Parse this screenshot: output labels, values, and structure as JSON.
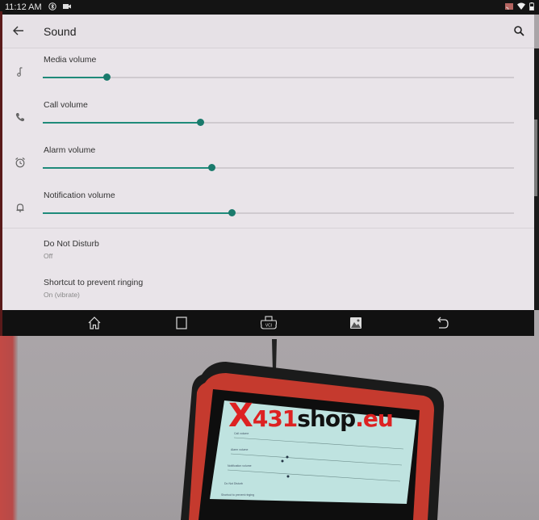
{
  "status_bar": {
    "time": "11:12 AM",
    "left_icons": [
      "bluetooth-icon",
      "video-camera-icon"
    ],
    "right_icons": [
      "cast-icon",
      "wifi-icon",
      "battery-icon"
    ]
  },
  "app_bar": {
    "title": "Sound",
    "back_icon": "arrow-left-icon",
    "search_icon": "search-icon"
  },
  "volumes": [
    {
      "label": "Media volume",
      "icon": "music-note-icon",
      "level": 0.135
    },
    {
      "label": "Call volume",
      "icon": "phone-icon",
      "level": 0.334
    },
    {
      "label": "Alarm volume",
      "icon": "alarm-clock-icon",
      "level": 0.358
    },
    {
      "label": "Notification volume",
      "icon": "bell-icon",
      "level": 0.4
    }
  ],
  "preferences": [
    {
      "title": "Do Not Disturb",
      "summary": "Off"
    },
    {
      "title": "Shortcut to prevent ringing",
      "summary": "On (vibrate)"
    }
  ],
  "nav_bar": {
    "buttons": [
      "home-icon",
      "recents-icon",
      "vci-icon",
      "gallery-icon",
      "back-icon"
    ],
    "vci_label": "VCI"
  },
  "photo": {
    "watermark": {
      "x": "X",
      "num": "431",
      "shop": "shop",
      "tld": ".eu"
    },
    "tablet_screen_items": [
      "Call volume",
      "Alarm volume",
      "Notification volume",
      "Do Not Disturb",
      "Shortcut to prevent ringing"
    ]
  },
  "colors": {
    "accent": "#1a7a6c",
    "track": "#cfcacf",
    "background": "#e9e4e9",
    "navbar": "#111111"
  }
}
